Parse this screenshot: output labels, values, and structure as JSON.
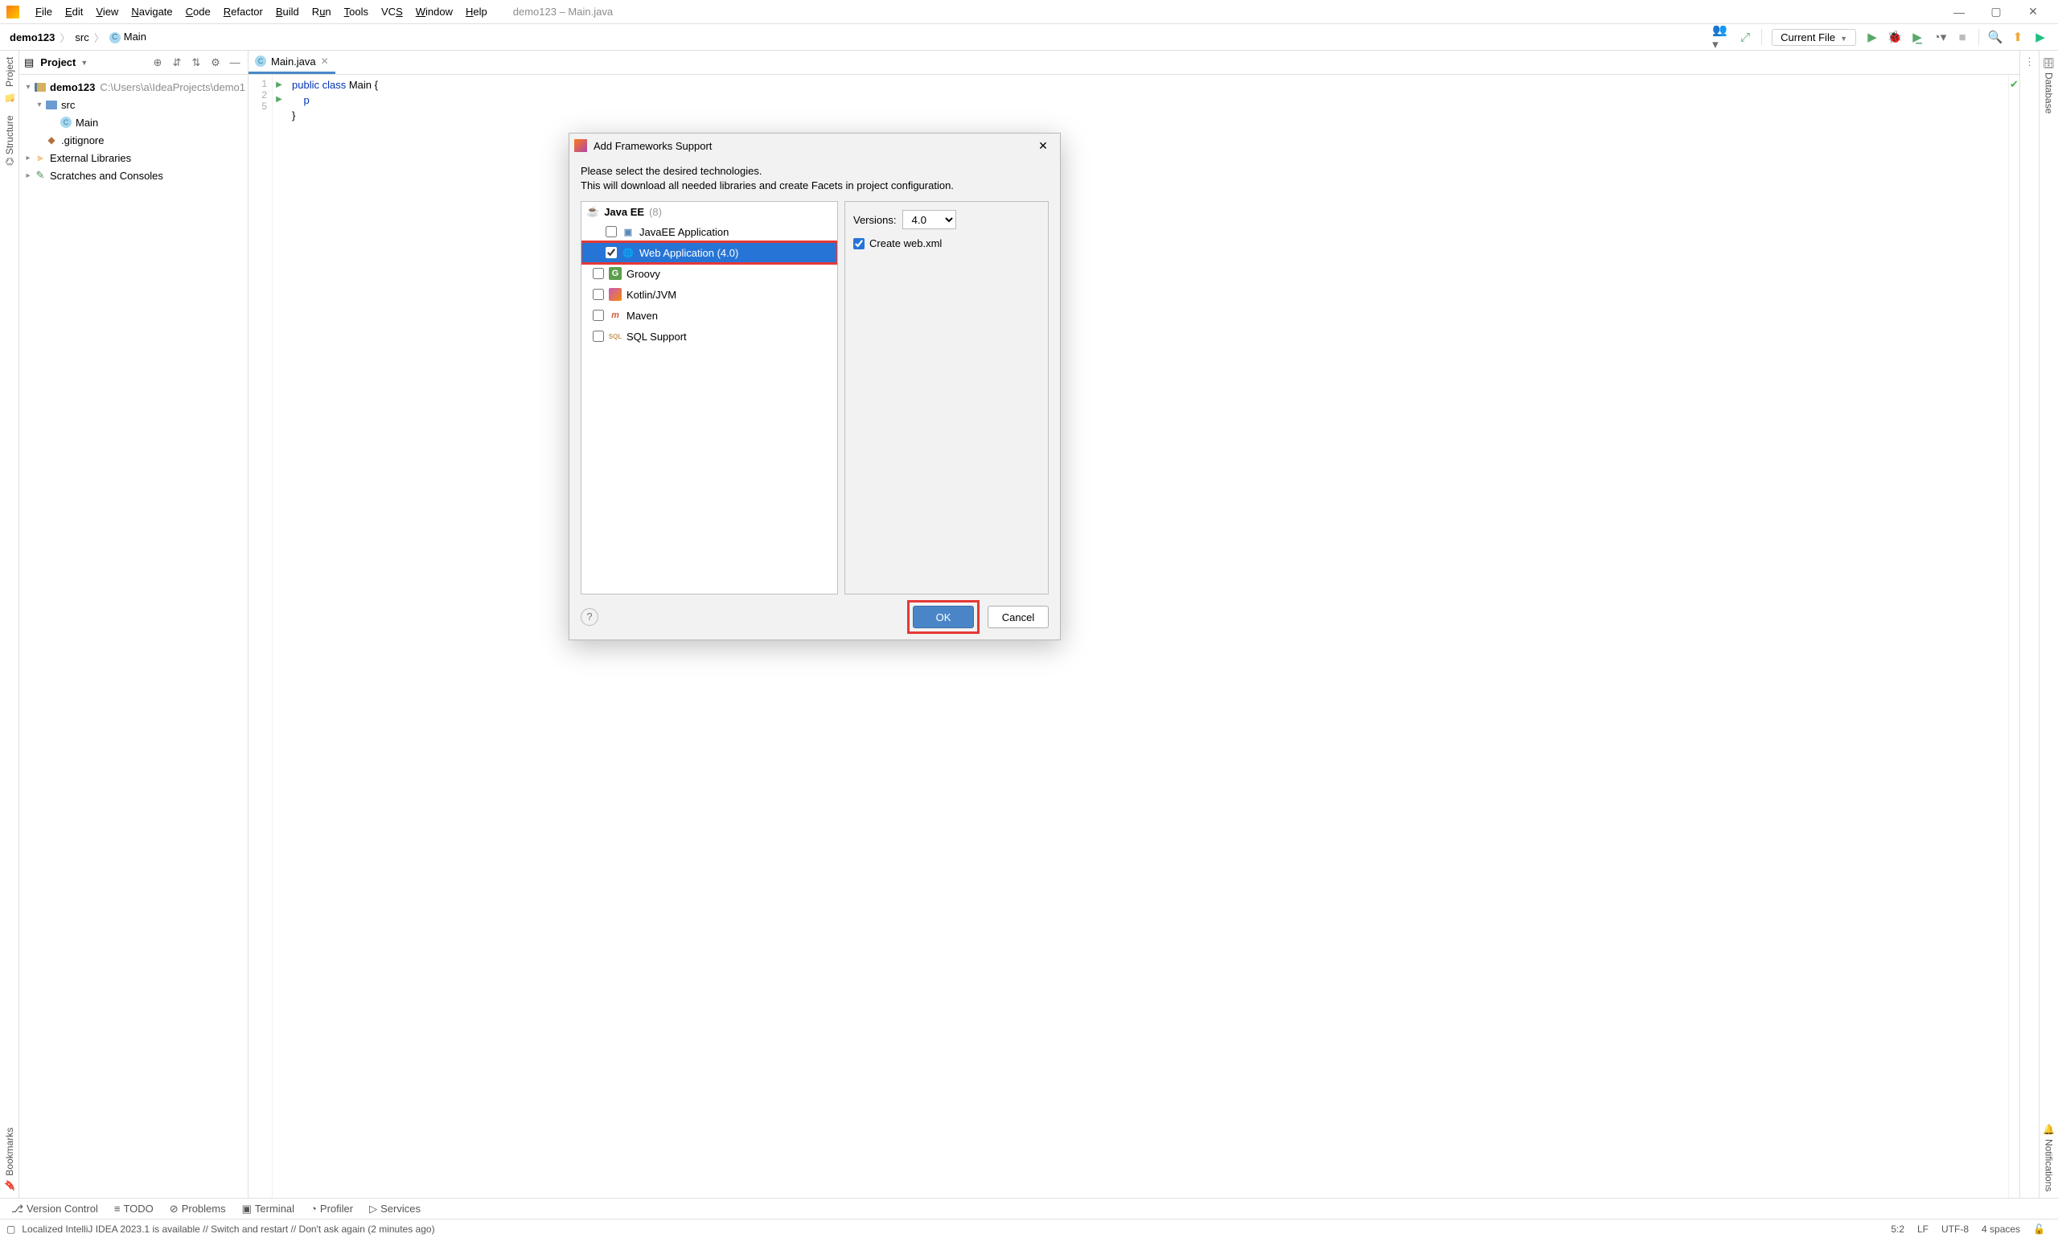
{
  "menubar": {
    "items": [
      "File",
      "Edit",
      "View",
      "Navigate",
      "Code",
      "Refactor",
      "Build",
      "Run",
      "Tools",
      "VCS",
      "Window",
      "Help"
    ],
    "title": "demo123 – Main.java"
  },
  "breadcrumb": {
    "project": "demo123",
    "folder": "src",
    "file": "Main"
  },
  "runConfig": {
    "label": "Current File"
  },
  "projectPanel": {
    "title": "Project",
    "root": {
      "name": "demo123",
      "path": "C:\\Users\\a\\IdeaProjects\\demo1"
    },
    "src": "src",
    "mainClass": "Main",
    "gitignore": ".gitignore",
    "externalLibraries": "External Libraries",
    "scratches": "Scratches and Consoles"
  },
  "editor": {
    "tabName": "Main.java",
    "lines": [
      "1",
      "2",
      "5"
    ],
    "code1_kw": "public class ",
    "code1_id": "Main ",
    "code1_br": "{",
    "code2_kw": "    p",
    "code3": "}"
  },
  "dialog": {
    "title": "Add Frameworks Support",
    "desc1": "Please select the desired technologies.",
    "desc2": "This will download all needed libraries and create Facets in project configuration.",
    "category": "Java EE",
    "categoryCount": "(8)",
    "items": {
      "javaeeApp": "JavaEE Application",
      "webApp": "Web Application (4.0)",
      "groovy": "Groovy",
      "kotlin": "Kotlin/JVM",
      "maven": "Maven",
      "sql": "SQL Support"
    },
    "versionsLabel": "Versions:",
    "versionValue": "4.0",
    "createWebXml": "Create web.xml",
    "ok": "OK",
    "cancel": "Cancel"
  },
  "bottomTools": {
    "versionControl": "Version Control",
    "todo": "TODO",
    "problems": "Problems",
    "terminal": "Terminal",
    "profiler": "Profiler",
    "services": "Services"
  },
  "statusbar": {
    "message": "Localized IntelliJ IDEA 2023.1 is available // Switch and restart // Don't ask again (2 minutes ago)",
    "pos": "5:2",
    "le": "LF",
    "enc": "UTF-8",
    "indent": "4 spaces"
  },
  "sideLabels": {
    "project": "Project",
    "structure": "Structure",
    "bookmarks": "Bookmarks",
    "database": "Database",
    "notifications": "Notifications"
  }
}
